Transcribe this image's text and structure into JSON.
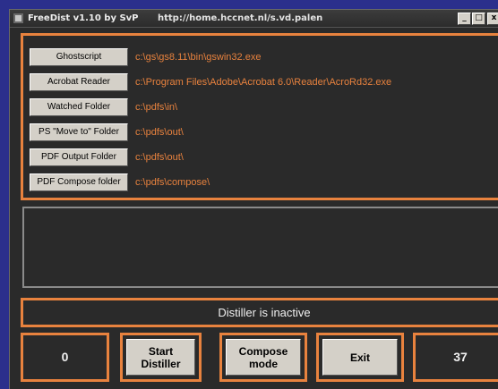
{
  "window": {
    "title": "FreeDist v1.10 by SvP",
    "url": "http://home.hccnet.nl/s.vd.palen",
    "min_label": "_",
    "max_label": "□",
    "close_label": "x"
  },
  "paths": [
    {
      "label": "Ghostscript",
      "value": "c:\\gs\\gs8.11\\bin\\gswin32.exe"
    },
    {
      "label": "Acrobat Reader",
      "value": "c:\\Program Files\\Adobe\\Acrobat 6.0\\Reader\\AcroRd32.exe"
    },
    {
      "label": "Watched Folder",
      "value": "c:\\pdfs\\in\\"
    },
    {
      "label": "PS \"Move to\" Folder",
      "value": "c:\\pdfs\\out\\"
    },
    {
      "label": "PDF Output Folder",
      "value": "c:\\pdfs\\out\\"
    },
    {
      "label": "PDF Compose folder",
      "value": "c:\\pdfs\\compose\\"
    }
  ],
  "status": "Distiller is inactive",
  "counter_left": "0",
  "counter_right": "37",
  "controls": {
    "start_line1": "Start",
    "start_line2": "Distiller",
    "compose_line1": "Compose",
    "compose_line2": "mode",
    "exit": "Exit"
  },
  "colors": {
    "accent": "#e8823e",
    "background": "#2a2a2a",
    "desktop": "#2b2f8c"
  }
}
